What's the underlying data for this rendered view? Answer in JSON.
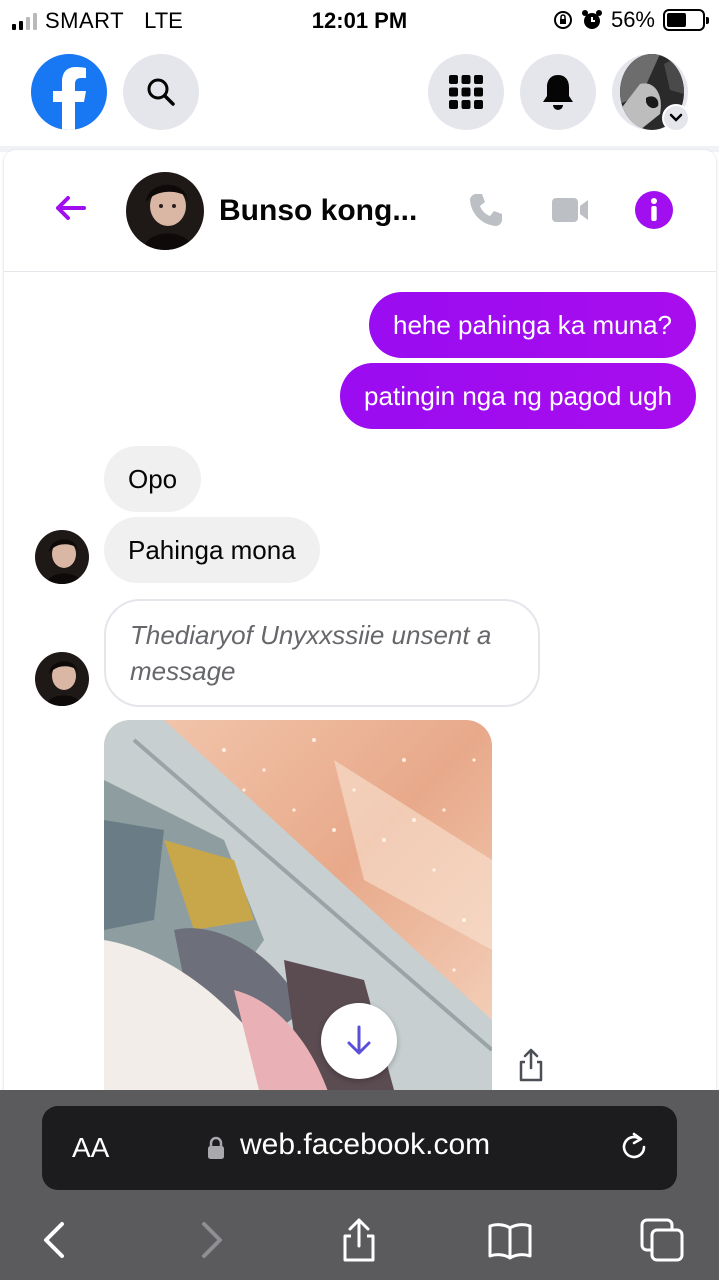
{
  "status_bar": {
    "carrier": "SMART",
    "network": "LTE",
    "time": "12:01 PM",
    "battery_percent": "56%",
    "battery_level": 0.56,
    "icons": [
      "signal-icon",
      "orientation-lock-icon",
      "alarm-icon",
      "battery-icon"
    ]
  },
  "fb_header": {
    "logo_icon": "facebook-logo-icon",
    "search_icon": "search-icon",
    "menu_icon": "grid-menu-icon",
    "notifications_icon": "bell-icon",
    "profile_icon": "profile-avatar",
    "brand_color": "#1877f2"
  },
  "chat": {
    "contact_name": "Bunso kong...",
    "accent_color": "#a10ef0",
    "header_icons": [
      "back-arrow-icon",
      "phone-icon",
      "video-icon",
      "info-icon"
    ]
  },
  "messages": {
    "sent": [
      "hehe pahinga ka muna?",
      "patingin nga ng pagod ugh"
    ],
    "received": [
      "Opo",
      "Pahinga mona"
    ],
    "unsent_notice": "Thediaryof Unyxxssiie unsent a message",
    "attachment_icons": [
      "download-icon",
      "share-icon"
    ]
  },
  "safari": {
    "text_size_label": "AA",
    "url": "web.facebook.com",
    "toolbar_icons": [
      "back-icon",
      "forward-icon",
      "share-icon",
      "bookmarks-icon",
      "tabs-icon"
    ],
    "reload_icon": "reload-icon",
    "lock_icon": "lock-icon"
  }
}
